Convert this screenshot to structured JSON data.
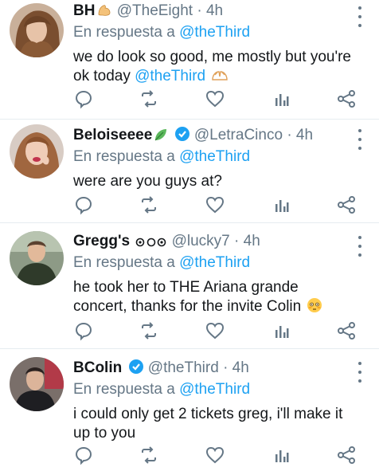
{
  "reply_prefix": "En respuesta a",
  "tweets": [
    {
      "name": "BH",
      "handle": "@TheEight",
      "separator": "·",
      "time": "4h",
      "reply_to": "@theThird",
      "body_text": "we do look so good, me mostly but you're ok today ",
      "body_mention": "@theThird",
      "name_emoji": "flexed-biceps",
      "body_emoji": "pleading-hands",
      "verified": false,
      "avatar": "woman-with-long-hair"
    },
    {
      "name": "Beloiseeee",
      "handle": "@LetraCinco",
      "separator": "·",
      "time": "4h",
      "reply_to": "@theThird",
      "body_text": "were are you guys at?",
      "name_emoji": "leaf",
      "verified": true,
      "avatar": "woman-blowing-kiss"
    },
    {
      "name": "Gregg's",
      "handle": "@lucky7",
      "separator": "·",
      "time": "4h",
      "reply_to": "@theThird",
      "body_text": "he took her to THE Ariana grande concert, thanks for the invite Colin ",
      "name_emoji": "swirl-symbols",
      "body_emoji": "flushed-face",
      "verified": false,
      "avatar": "young-man-outdoors"
    },
    {
      "name": "BColin",
      "handle": "@theThird",
      "separator": "·",
      "time": "4h",
      "reply_to": "@theThird",
      "body_text": "i could only get 2 tickets greg, i'll make it up to you",
      "verified": true,
      "avatar": "man-in-dark-shirt"
    }
  ],
  "action_icons": [
    "reply-icon",
    "retweet-icon",
    "like-icon",
    "analytics-icon",
    "share-icon"
  ],
  "colors": {
    "accent": "#1da1f2",
    "secondary_text": "#657786",
    "divider": "#e6ecf0"
  }
}
